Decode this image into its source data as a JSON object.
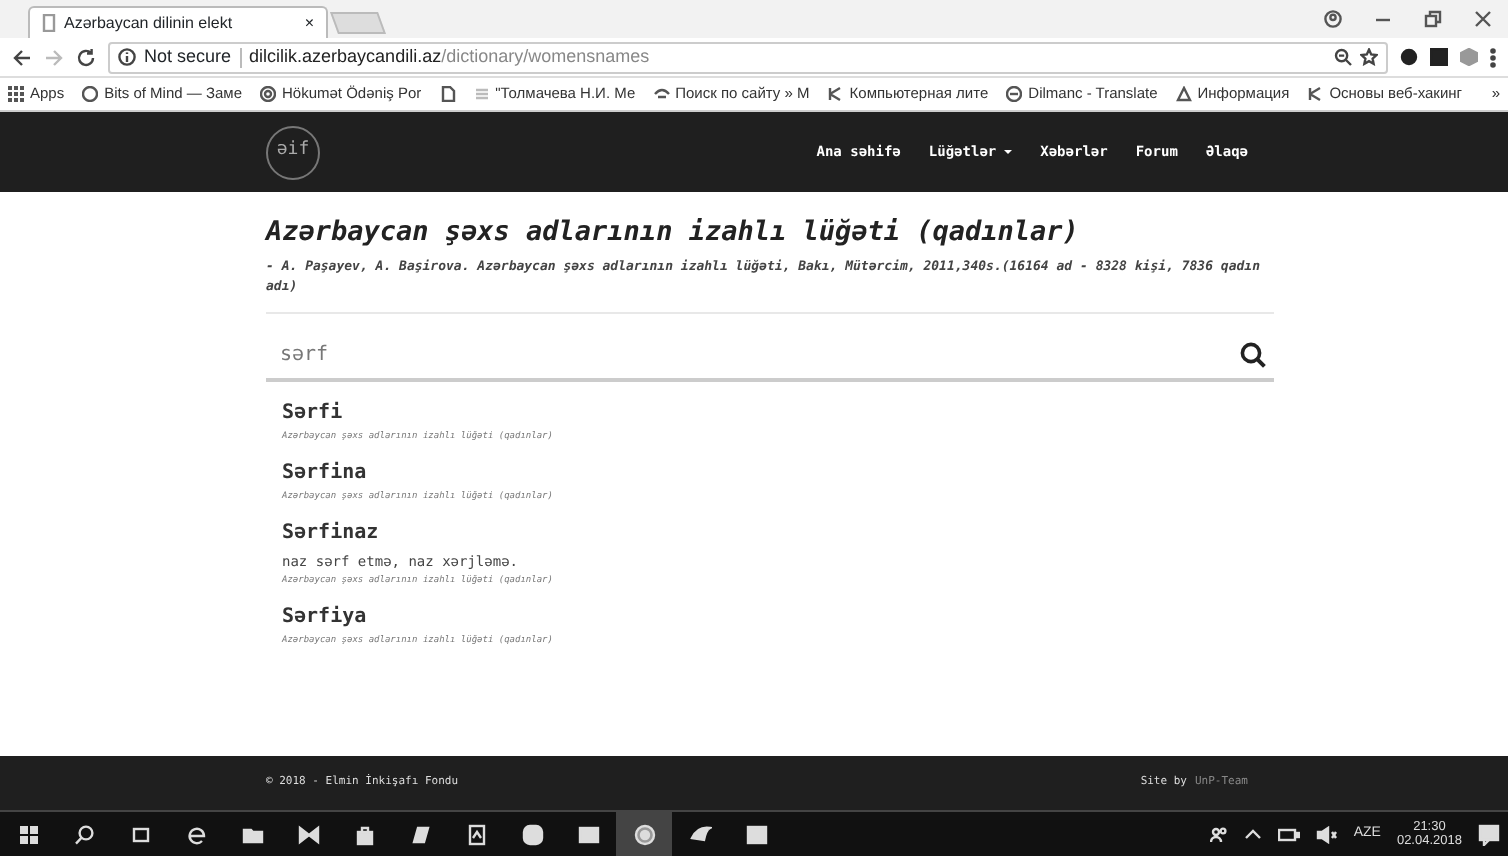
{
  "browser": {
    "tab_title": "Azərbaycan dilinin elekt",
    "tab_close": "×",
    "security": "Not secure",
    "url_host": "dilcilik.azerbaycandili.az",
    "url_path": "/dictionary/womensnames",
    "bookmarks": [
      {
        "kind": "labeled",
        "label": "Apps"
      },
      {
        "kind": "labeled",
        "label": "Bits of Mind — Заме"
      },
      {
        "kind": "labeled",
        "label": "Hökumət Ödəniş Por"
      },
      {
        "kind": "icon"
      },
      {
        "kind": "labeled",
        "label": "\"Толмачева Н.И. Ме"
      },
      {
        "kind": "labeled",
        "label": "Поиск по сайту » М"
      },
      {
        "kind": "labeled",
        "label": "Компьютерная лите"
      },
      {
        "kind": "labeled",
        "label": "Dilmanc - Translate"
      },
      {
        "kind": "labeled",
        "label": "Информация"
      },
      {
        "kind": "labeled",
        "label": "Основы веб-хакинг"
      }
    ],
    "more": "»"
  },
  "navbar": {
    "logo": "əif",
    "items": [
      {
        "label": "Ana səhifə",
        "dropdown": false
      },
      {
        "label": "Lüğətlər",
        "dropdown": true
      },
      {
        "label": "Xəbərlər",
        "dropdown": false
      },
      {
        "label": "Forum",
        "dropdown": false
      },
      {
        "label": "Əlaqə",
        "dropdown": false
      }
    ]
  },
  "page": {
    "title": "Azərbaycan şəxs adlarının izahlı lüğəti (qadınlar)",
    "subtitle": "- A. Paşayev, A. Başirova. Azərbaycan şəxs adlarının izahlı lüğəti, Bakı, Mütərcim, 2011,340s.(16164 ad - 8328 kişi, 7836 qadın adı)",
    "search": {
      "value": "sərf"
    },
    "results": [
      {
        "name": "Sərfi",
        "source": "Azərbaycan şəxs adlarının izahlı lüğəti (qadınlar)"
      },
      {
        "name": "Sərfina",
        "source": "Azərbaycan şəxs adlarının izahlı lüğəti (qadınlar)"
      },
      {
        "name": "Sərfinaz",
        "meaning": "naz sərf etmə, naz xərjləmə.",
        "source": "Azərbaycan şəxs adlarının izahlı lüğəti (qadınlar)"
      },
      {
        "name": "Sərfiya",
        "source": "Azərbaycan şəxs adlarının izahlı lüğəti (qadınlar)"
      }
    ]
  },
  "footer": {
    "copyright": "© 2018 - Elmin İnkişafı Fondu",
    "credit": "Site by",
    "credit_link": "UnP-Team"
  },
  "taskbar": {
    "apps": [
      {
        "selected": false
      },
      {
        "selected": false
      },
      {
        "selected": false
      },
      {
        "selected": false
      },
      {
        "selected": false
      },
      {
        "selected": false
      },
      {
        "selected": false
      },
      {
        "selected": false
      },
      {
        "selected": false
      },
      {
        "selected": true
      },
      {
        "selected": false
      },
      {
        "selected": false
      }
    ],
    "language": "AZE",
    "time": "21:30",
    "date": "02.04.2018"
  }
}
